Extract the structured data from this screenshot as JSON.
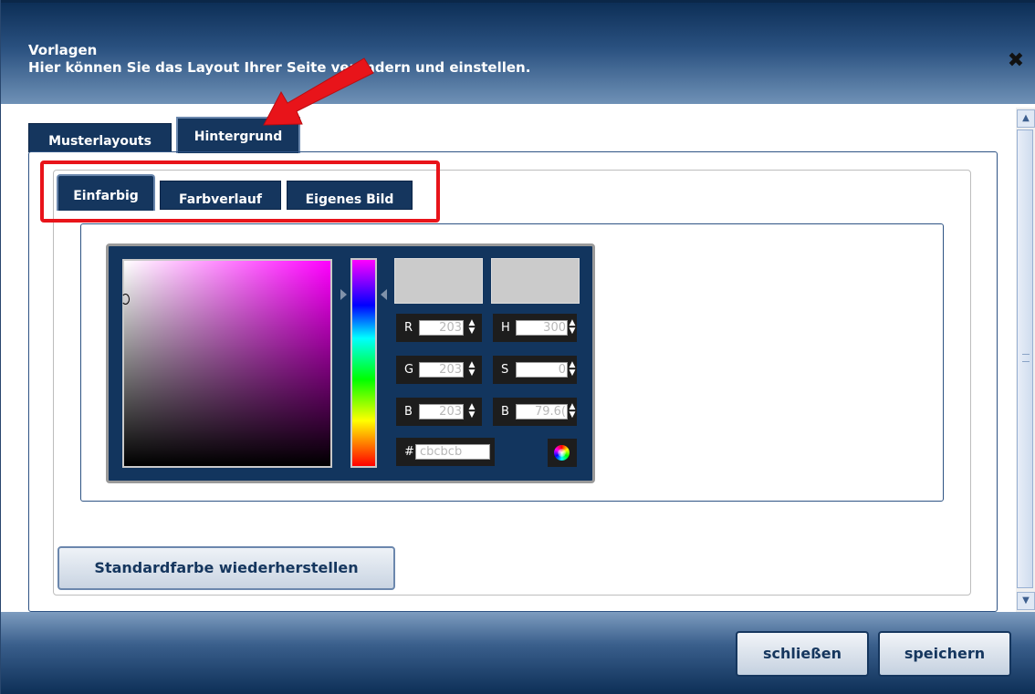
{
  "header": {
    "title": "Vorlagen",
    "subtitle": "Hier können Sie das Layout Ihrer Seite verändern und einstellen.",
    "close_icon": "close-icon"
  },
  "outer_tabs": [
    {
      "label": "Musterlayouts",
      "active": false
    },
    {
      "label": "Hintergrund",
      "active": true
    }
  ],
  "inner_tabs": [
    {
      "label": "Einfarbig",
      "active": true
    },
    {
      "label": "Farbverlauf",
      "active": false
    },
    {
      "label": "Eigenes Bild",
      "active": false
    }
  ],
  "color_picker": {
    "fields": {
      "r": {
        "label": "R",
        "value": "203"
      },
      "g": {
        "label": "G",
        "value": "203"
      },
      "b": {
        "label": "B",
        "value": "203"
      },
      "h": {
        "label": "H",
        "value": "300"
      },
      "s": {
        "label": "S",
        "value": "0"
      },
      "br": {
        "label": "B",
        "value": "79.6("
      }
    },
    "hex": {
      "label": "#",
      "value": "cbcbcb"
    },
    "current_color": "#cbcbcb",
    "previous_color": "#cbcbcb",
    "hue_color": "#ff00ff"
  },
  "restore_button": "Standardfarbe wiederherstellen",
  "footer": {
    "close_label": "schließen",
    "save_label": "speichern"
  },
  "colors": {
    "accent": "#15365e",
    "highlight": "#e8141a"
  }
}
